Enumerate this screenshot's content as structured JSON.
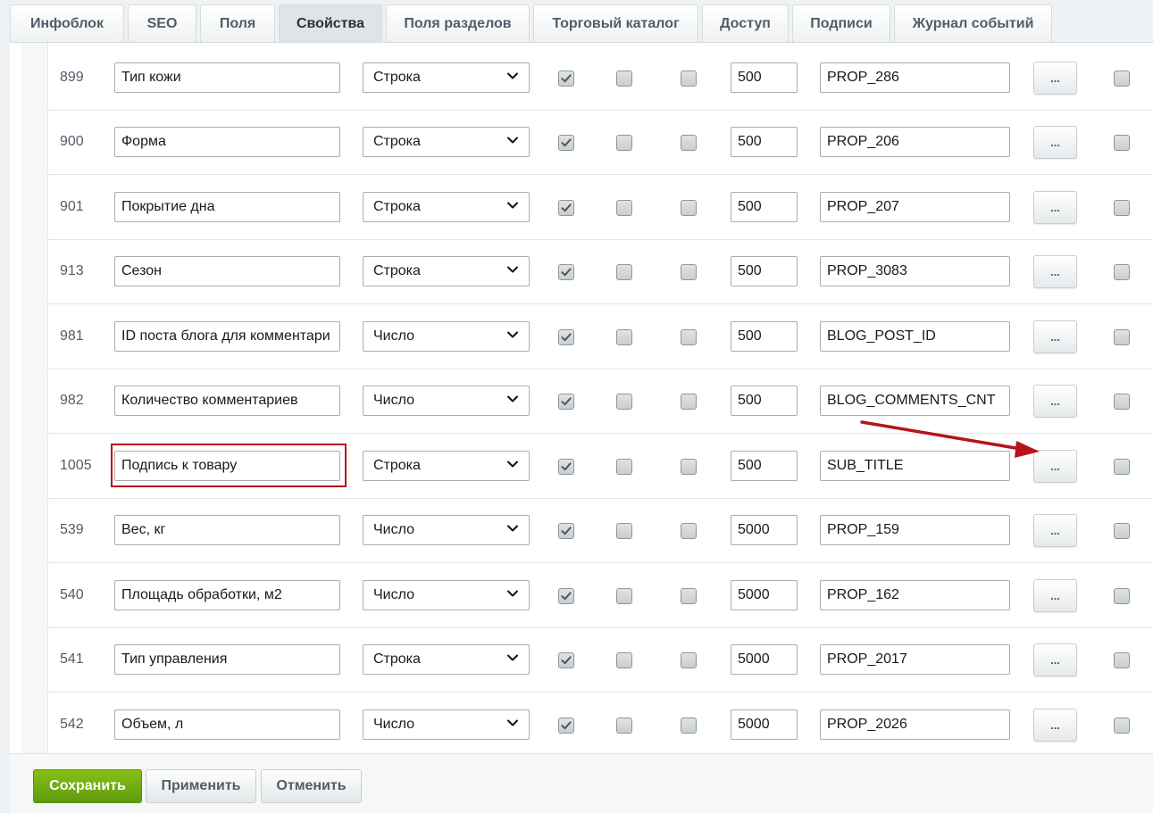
{
  "tabs": [
    {
      "label": "Инфоблок"
    },
    {
      "label": "SEO"
    },
    {
      "label": "Поля"
    },
    {
      "label": "Свойства"
    },
    {
      "label": "Поля разделов"
    },
    {
      "label": "Торговый каталог"
    },
    {
      "label": "Доступ"
    },
    {
      "label": "Подписи"
    },
    {
      "label": "Журнал событий"
    }
  ],
  "active_tab": "Свойства",
  "rows": [
    {
      "id": "899",
      "name": "Тип кожи",
      "type": "Строка",
      "c1": true,
      "c2": false,
      "c3": false,
      "sort": "500",
      "code": "PROP_286",
      "more": "...",
      "c4": false
    },
    {
      "id": "900",
      "name": "Форма",
      "type": "Строка",
      "c1": true,
      "c2": false,
      "c3": false,
      "sort": "500",
      "code": "PROP_206",
      "more": "...",
      "c4": false
    },
    {
      "id": "901",
      "name": "Покрытие дна",
      "type": "Строка",
      "c1": true,
      "c2": false,
      "c3": false,
      "sort": "500",
      "code": "PROP_207",
      "more": "...",
      "c4": false
    },
    {
      "id": "913",
      "name": "Сезон",
      "type": "Строка",
      "c1": true,
      "c2": false,
      "c3": false,
      "sort": "500",
      "code": "PROP_3083",
      "more": "...",
      "c4": false
    },
    {
      "id": "981",
      "name": "ID поста блога для комментари",
      "type": "Число",
      "c1": true,
      "c2": false,
      "c3": false,
      "sort": "500",
      "code": "BLOG_POST_ID",
      "more": "...",
      "c4": false
    },
    {
      "id": "982",
      "name": "Количество комментариев",
      "type": "Число",
      "c1": true,
      "c2": false,
      "c3": false,
      "sort": "500",
      "code": "BLOG_COMMENTS_CNT",
      "more": "...",
      "c4": false
    },
    {
      "id": "1005",
      "name": "Подпись к товару",
      "type": "Строка",
      "c1": true,
      "c2": false,
      "c3": false,
      "sort": "500",
      "code": "SUB_TITLE",
      "more": "...",
      "c4": false
    },
    {
      "id": "539",
      "name": "Вес, кг",
      "type": "Число",
      "c1": true,
      "c2": false,
      "c3": false,
      "sort": "5000",
      "code": "PROP_159",
      "more": "...",
      "c4": false
    },
    {
      "id": "540",
      "name": "Площадь обработки, м2",
      "type": "Число",
      "c1": true,
      "c2": false,
      "c3": false,
      "sort": "5000",
      "code": "PROP_162",
      "more": "...",
      "c4": false
    },
    {
      "id": "541",
      "name": "Тип управления",
      "type": "Строка",
      "c1": true,
      "c2": false,
      "c3": false,
      "sort": "5000",
      "code": "PROP_2017",
      "more": "...",
      "c4": false
    },
    {
      "id": "542",
      "name": "Объем, л",
      "type": "Число",
      "c1": true,
      "c2": false,
      "c3": false,
      "sort": "5000",
      "code": "PROP_2026",
      "more": "...",
      "c4": false
    }
  ],
  "footer": {
    "save_label": "Сохранить",
    "apply_label": "Применить",
    "cancel_label": "Отменить"
  },
  "colors": {
    "highlight": "#b7131a",
    "save_button": "#6fa911",
    "arrow": "#b7131a"
  },
  "icons": {
    "select_arrow": "chevron-down-icon",
    "checkbox_mark": "check-icon"
  }
}
